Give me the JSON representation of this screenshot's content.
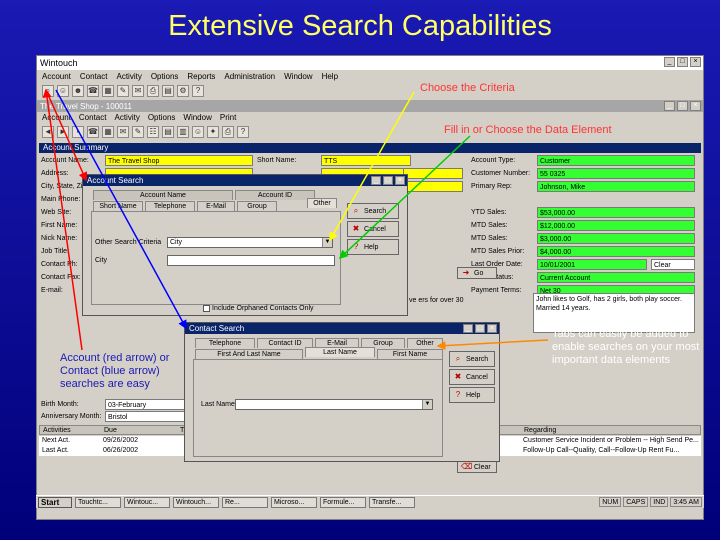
{
  "slide": {
    "title": "Extensive Search Capabilities"
  },
  "app": {
    "title": "Wintouch",
    "menu": [
      "Account",
      "Contact",
      "Activity",
      "Options",
      "Reports",
      "Administration",
      "Window",
      "Help"
    ],
    "child_title": "The Travel Shop - 100011",
    "child_menu": [
      "Account",
      "Contact",
      "Activity",
      "Options",
      "Window",
      "Print"
    ]
  },
  "summary": {
    "header": "Account Summary",
    "labels_left": [
      "Account Name:",
      "Address:",
      "City, State, Zip:",
      "Main Phone:",
      "Web Site:",
      "First Name:",
      "Nick Name:",
      "Job Title:",
      "Contact Ph:",
      "Contact Fax:",
      "E-mail:"
    ],
    "account_name": "The Travel Shop",
    "short_name_label": "Short Name:",
    "short_name": "TTS",
    "labels_right": [
      "Account Type:",
      "Customer Number:",
      "Primary Rep:",
      "YTD Sales:",
      "MTD Sales:",
      "MTD Sales:",
      "MTD Sales Prior:",
      "Last Order Date:",
      "Credit Status:",
      "Payment Terms:"
    ],
    "values_right": [
      "Customer",
      "55 0325",
      "Johnson, Mike",
      "$53,000.00",
      "$12,000.00",
      "$3,000.00",
      "$4,000.00",
      "",
      "Current Account",
      "Net 30"
    ],
    "last_order_values": [
      "10/01/2001",
      "Clear"
    ],
    "notes_frag": "ve ers for over 30",
    "notes": "John likes to Golf, has 2 girls, both play soccer. Married 14 years.",
    "bottom_labels": [
      "Birth Month:",
      "Anniversary Month:"
    ],
    "birth_month": "03-February",
    "anniv_month": "Bristol"
  },
  "activities": {
    "columns": [
      "Activities",
      "Due",
      "T",
      "Regarding"
    ],
    "rows": [
      [
        "Next Act.",
        "09/26/2002",
        "",
        "Customer Service Incident or Problem -- High Send Pe..."
      ],
      [
        "Last Act.",
        "06/26/2002",
        "",
        "Follow-Up Call--Quality, Call--Follow-Up Rent Fu..."
      ]
    ]
  },
  "account_search": {
    "title": "Account Search",
    "tab_groups": [
      "Account Name",
      "Account ID"
    ],
    "tabs": [
      "Short Name",
      "Telephone",
      "E-Mail",
      "Group",
      "Other"
    ],
    "other_criteria_label": "Other Search Criteria",
    "other_criteria_value": "City",
    "city_label": "City",
    "city_value": "",
    "checkbox_label": "Include Orphaned Contacts Only",
    "buttons": [
      "Search",
      "Cancel",
      "Help"
    ]
  },
  "contact_search": {
    "title": "Contact Search",
    "tabs_top": [
      "Telephone",
      "Contact ID",
      "E-Mail",
      "Group",
      "Other"
    ],
    "tabs_bottom": [
      "First And Last Name",
      "Last Name",
      "First Name"
    ],
    "last_name_label": "Last Name",
    "last_name_value": "",
    "buttons": [
      "Search",
      "Cancel",
      "Help"
    ]
  },
  "right_side_buttons": [
    "Go",
    "Clear"
  ],
  "taskbar": {
    "start": "Start",
    "tasks": [
      "Touchtc...",
      "Wintouc...",
      "Wintouch...",
      "Re...",
      "Microso...",
      "Formule...",
      "Transfe..."
    ],
    "tray": [
      "NUM",
      "CAPS",
      "IND",
      "3:45 AM"
    ]
  },
  "callouts": {
    "criteria": "Choose the Criteria",
    "fill": "Fill in or Choose the Data Element",
    "tabs": "Tabs can easily be added to enable searches on your most important data elements",
    "account": "Account (red arrow) or Contact (blue arrow) searches are easy"
  },
  "colors": {
    "slide_bg": "#1a1ab4",
    "title": "#ffff66",
    "highlight_yellow": "#ffff00",
    "highlight_green": "#33ff33",
    "dialog_title": "#0a246a",
    "arrow_red": "#ff0000",
    "arrow_blue": "#0000ff",
    "arrow_yellow": "#ffff00",
    "arrow_green": "#00cc00",
    "arrow_orange": "#ff8800"
  }
}
